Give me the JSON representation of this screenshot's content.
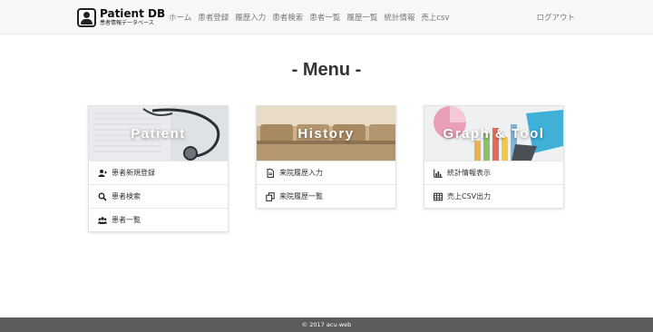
{
  "brand": {
    "title": "Patient DB",
    "subtitle": "患者情報データベース"
  },
  "nav": {
    "links": [
      "ホーム",
      "患者登録",
      "履歴入力",
      "患者検索",
      "患者一覧",
      "履歴一覧",
      "統計情報",
      "売上csv"
    ],
    "logout": "ログアウト"
  },
  "heading": "- Menu -",
  "cards": [
    {
      "title": "Patient",
      "items": [
        {
          "label": "患者新規登録",
          "icon": "user-plus-icon"
        },
        {
          "label": "患者検索",
          "icon": "search-icon"
        },
        {
          "label": "患者一覧",
          "icon": "users-icon"
        }
      ]
    },
    {
      "title": "History",
      "items": [
        {
          "label": "来院履歴入力",
          "icon": "document-icon"
        },
        {
          "label": "来院履歴一覧",
          "icon": "copy-icon"
        }
      ]
    },
    {
      "title": "Graph & Tool",
      "items": [
        {
          "label": "統計情報表示",
          "icon": "bar-chart-icon"
        },
        {
          "label": "売上CSV出力",
          "icon": "table-icon"
        }
      ]
    }
  ],
  "footer": "© 2017 acu-web"
}
